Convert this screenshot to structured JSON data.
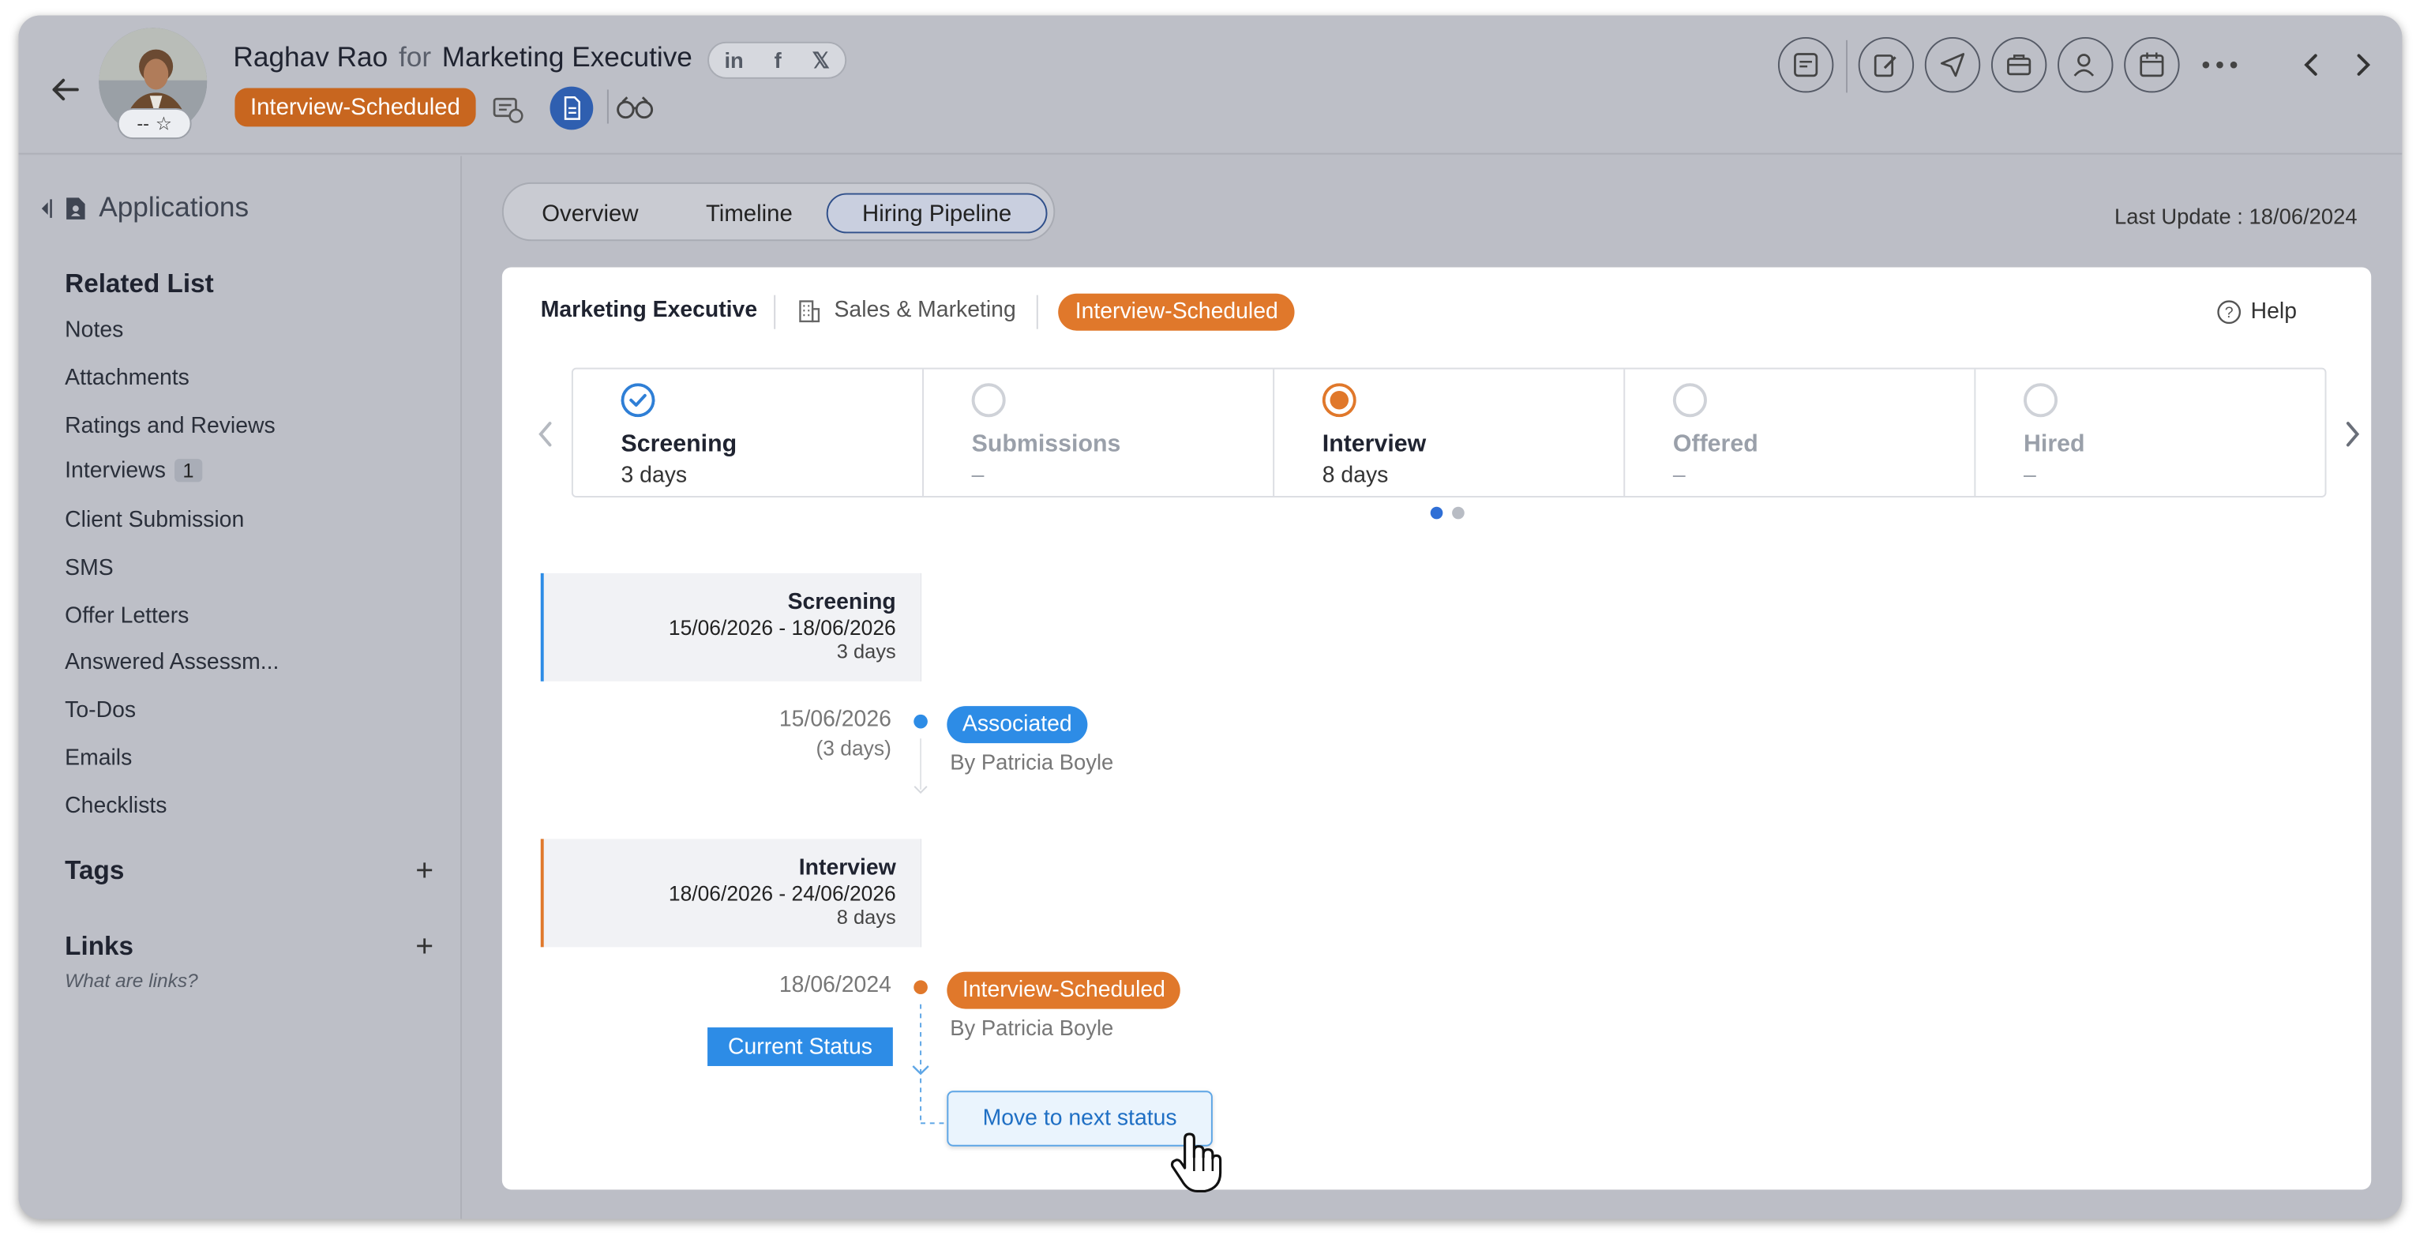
{
  "candidate": {
    "name": "Raghav Rao",
    "for_word": "for",
    "job": "Marketing Executive",
    "status": "Interview-Scheduled",
    "rating_text": "--"
  },
  "social": {
    "linkedin": "in",
    "facebook": "f",
    "x": "𝕏"
  },
  "sidebar": {
    "applications_label": "Applications",
    "related_title": "Related List",
    "items": [
      {
        "label": "Notes"
      },
      {
        "label": "Attachments"
      },
      {
        "label": "Ratings and Reviews"
      },
      {
        "label": "Interviews",
        "count": "1"
      },
      {
        "label": "Client Submission"
      },
      {
        "label": "SMS"
      },
      {
        "label": "Offer Letters"
      },
      {
        "label": "Answered Assessm..."
      },
      {
        "label": "To-Dos"
      },
      {
        "label": "Emails"
      },
      {
        "label": "Checklists"
      }
    ],
    "tags_title": "Tags",
    "links_title": "Links",
    "links_help": "What are links?"
  },
  "tabs": [
    {
      "label": "Overview"
    },
    {
      "label": "Timeline"
    },
    {
      "label": "Hiring Pipeline",
      "active": true
    }
  ],
  "last_update": "Last Update : 18/06/2024",
  "pipeline": {
    "job_title": "Marketing Executive",
    "department": "Sales & Marketing",
    "status": "Interview-Scheduled",
    "help_label": "Help",
    "stages": [
      {
        "name": "Screening",
        "days": "3 days",
        "state": "done"
      },
      {
        "name": "Submissions",
        "days": "–",
        "state": "pending"
      },
      {
        "name": "Interview",
        "days": "8 days",
        "state": "current"
      },
      {
        "name": "Offered",
        "days": "–",
        "state": "pending"
      },
      {
        "name": "Hired",
        "days": "–",
        "state": "pending"
      }
    ]
  },
  "timeline": {
    "blocks": [
      {
        "title": "Screening",
        "range": "15/06/2026 - 18/06/2026",
        "days": "3 days"
      },
      {
        "title": "Interview",
        "range": "18/06/2026 - 24/06/2026",
        "days": "8 days"
      }
    ],
    "events": [
      {
        "date": "15/06/2026",
        "sub": "(3 days)",
        "status": "Associated",
        "by": "By Patricia Boyle"
      },
      {
        "date": "18/06/2024",
        "current_label": "Current Status",
        "status": "Interview-Scheduled",
        "by": "By Patricia Boyle"
      }
    ],
    "move_label": "Move to next status"
  },
  "colors": {
    "accent_blue": "#2d8ce6",
    "status_orange": "#e0782b",
    "header_orange": "#c8661f"
  }
}
